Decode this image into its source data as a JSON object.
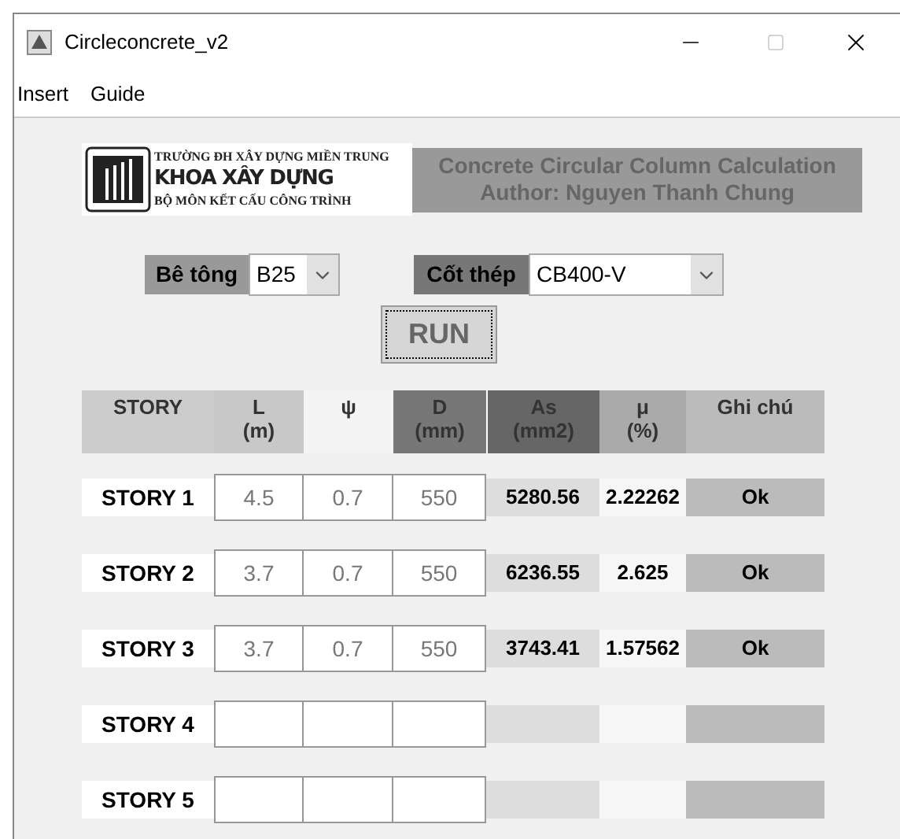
{
  "window": {
    "title": "Circleconcrete_v2"
  },
  "menu": [
    "Insert",
    "Guide"
  ],
  "logo": {
    "lines": [
      "TRƯỜNG ĐH XÂY DỰNG MIỀN TRUNG",
      "KHOA XÂY DỰNG",
      "BỘ MÔN KẾT CẤU CÔNG TRÌNH"
    ]
  },
  "banner": {
    "title": "Concrete Circular Column Calculation",
    "author": "Author: Nguyen Thanh Chung"
  },
  "concrete": {
    "label": "Bê tông",
    "value": "B25"
  },
  "steel": {
    "label": "Cốt thép",
    "value": "CB400-V"
  },
  "run_button": "RUN",
  "table": {
    "columns": [
      {
        "title": "STORY"
      },
      {
        "title": "L",
        "unit": "(m)"
      },
      {
        "title": "ψ"
      },
      {
        "title": "D",
        "unit": "(mm)"
      },
      {
        "title": "As",
        "unit": "(mm2)"
      },
      {
        "title": "μ",
        "unit": "(%)"
      },
      {
        "title": "Ghi chú"
      }
    ],
    "rows": [
      {
        "story": "STORY 1",
        "L": "4.5",
        "psi": "0.7",
        "D": "550",
        "As": "5280.56",
        "mu": "2.22262",
        "note": "Ok"
      },
      {
        "story": "STORY 2",
        "L": "3.7",
        "psi": "0.7",
        "D": "550",
        "As": "6236.55",
        "mu": "2.625",
        "note": "Ok"
      },
      {
        "story": "STORY 3",
        "L": "3.7",
        "psi": "0.7",
        "D": "550",
        "As": "3743.41",
        "mu": "1.57562",
        "note": "Ok"
      },
      {
        "story": "STORY 4"
      },
      {
        "story": "STORY 5"
      }
    ]
  }
}
